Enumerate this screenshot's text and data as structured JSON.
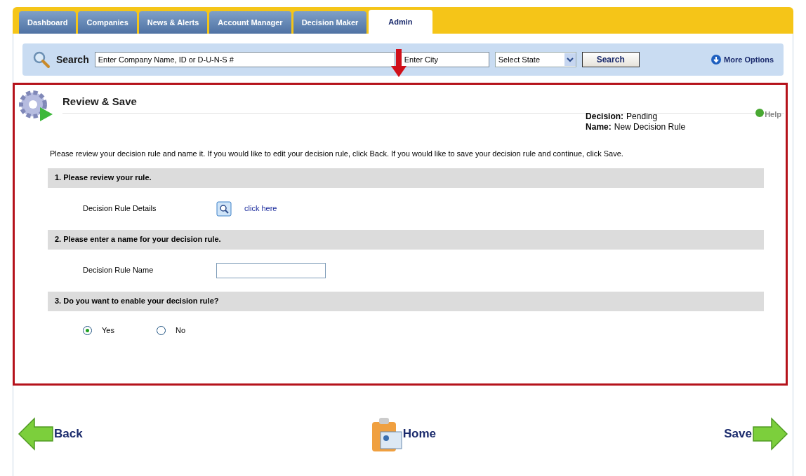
{
  "tabs": [
    {
      "label": "Dashboard",
      "selected": false
    },
    {
      "label": "Companies",
      "selected": false
    },
    {
      "label": "News & Alerts",
      "selected": false
    },
    {
      "label": "Account Manager",
      "selected": false
    },
    {
      "label": "Decision Maker",
      "selected": false
    },
    {
      "label": "Admin",
      "selected": true
    }
  ],
  "search": {
    "label": "Search",
    "company_placeholder": "Enter Company Name, ID or D-U-N-S #",
    "city_placeholder": "Enter City",
    "state_select": "Select State",
    "button": "Search",
    "more_options": "More Options"
  },
  "panel": {
    "title": "Review & Save",
    "help": "Help",
    "status": [
      {
        "label": "Decision:",
        "value": "Pending"
      },
      {
        "label": "Name:",
        "value": "New Decision Rule"
      }
    ],
    "intro": "Please review your decision rule and name it. If you would like to edit your decision rule, click Back. If you would like to save your decision rule and continue, click Save.",
    "sections": [
      {
        "kind": "link",
        "heading": "1. Please review your rule.",
        "label": "Decision Rule Details",
        "link": "click here"
      },
      {
        "kind": "input",
        "heading": "2. Please enter a name for your decision rule.",
        "label": "Decision Rule Name"
      },
      {
        "kind": "radio",
        "heading": "3. Do you want to enable your decision rule?",
        "options": [
          {
            "label": "Yes",
            "selected": true
          },
          {
            "label": "No",
            "selected": false
          }
        ]
      }
    ]
  },
  "nav": {
    "back": "Back",
    "home": "Home",
    "save": "Save"
  }
}
